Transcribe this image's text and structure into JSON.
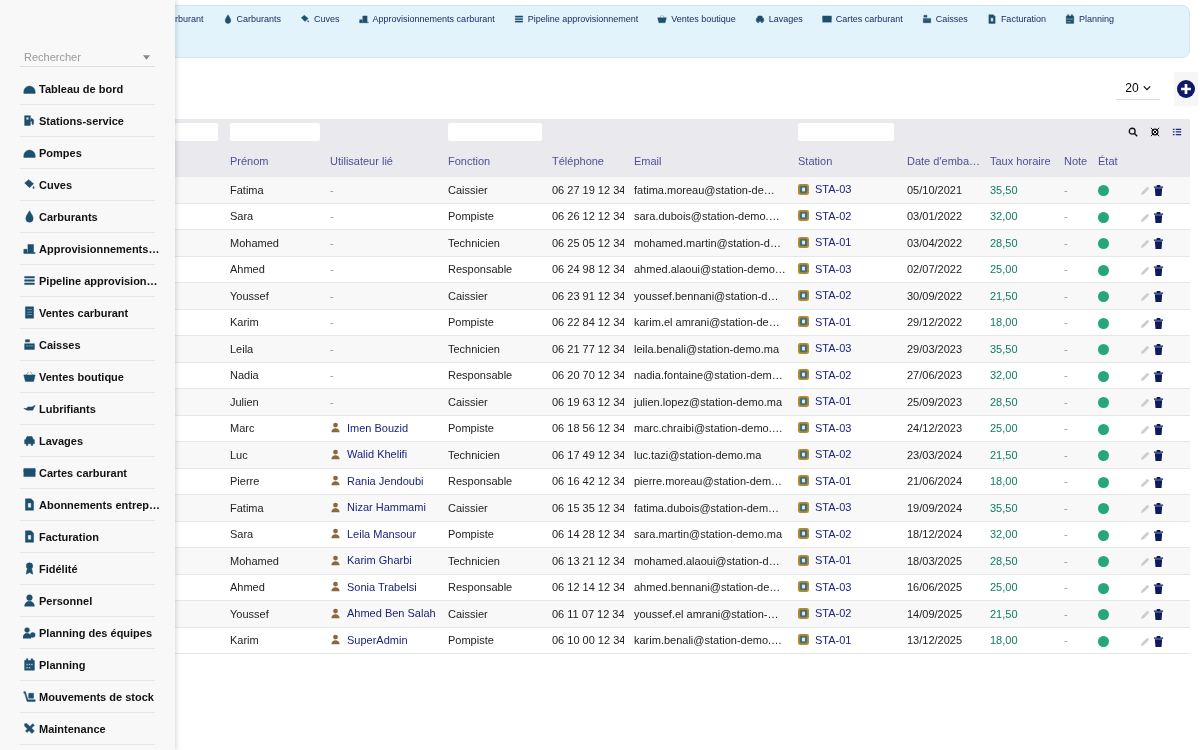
{
  "sidebar": {
    "search": {
      "placeholder": "Rechercher"
    },
    "items": [
      {
        "label": "Tableau de bord"
      },
      {
        "label": "Stations-service"
      },
      {
        "label": "Pompes"
      },
      {
        "label": "Cuves"
      },
      {
        "label": "Carburants"
      },
      {
        "label": "Approvisionnements…"
      },
      {
        "label": "Pipeline approvision…"
      },
      {
        "label": "Ventes carburant"
      },
      {
        "label": "Caisses"
      },
      {
        "label": "Ventes boutique"
      },
      {
        "label": "Lubrifiants"
      },
      {
        "label": "Lavages"
      },
      {
        "label": "Cartes carburant"
      },
      {
        "label": "Abonnements entrep…"
      },
      {
        "label": "Facturation"
      },
      {
        "label": "Fidélité"
      },
      {
        "label": "Personnel"
      },
      {
        "label": "Planning des équipes"
      },
      {
        "label": "Planning"
      },
      {
        "label": "Mouvements de stock"
      },
      {
        "label": "Maintenance"
      }
    ]
  },
  "top_nav": [
    {
      "label": "rburant"
    },
    {
      "label": "Carburants"
    },
    {
      "label": "Cuves"
    },
    {
      "label": "Approvisionnements carburant"
    },
    {
      "label": "Pipeline approvisionnement"
    },
    {
      "label": "Ventes boutique"
    },
    {
      "label": "Lavages"
    },
    {
      "label": "Cartes carburant"
    },
    {
      "label": "Caisses"
    },
    {
      "label": "Facturation"
    },
    {
      "label": "Planning"
    }
  ],
  "page_size": "20",
  "table": {
    "columns": [
      "Prénom",
      "Utilisateur lié",
      "Fonction",
      "Téléphone",
      "Email",
      "Station",
      "Date d'emba…",
      "Taux horaire",
      "Note",
      "État"
    ],
    "rows": [
      {
        "prenom": "Fatima",
        "user": "-",
        "linked": false,
        "fonction": "Caissier",
        "phone": "06 27 19 12 34",
        "email": "fatima.moreau@station-de…",
        "station": "STA-03",
        "date": "05/10/2021",
        "taux": "35,50",
        "note": "-",
        "active": true
      },
      {
        "prenom": "Sara",
        "user": "-",
        "linked": false,
        "fonction": "Pompiste",
        "phone": "06 26 12 12 34",
        "email": "sara.dubois@station-demo.…",
        "station": "STA-02",
        "date": "03/01/2022",
        "taux": "32,00",
        "note": "-",
        "active": true
      },
      {
        "prenom": "Mohamed",
        "user": "-",
        "linked": false,
        "fonction": "Technicien",
        "phone": "06 25 05 12 34",
        "email": "mohamed.martin@station-d…",
        "station": "STA-01",
        "date": "03/04/2022",
        "taux": "28,50",
        "note": "-",
        "active": true
      },
      {
        "prenom": "Ahmed",
        "user": "-",
        "linked": false,
        "fonction": "Responsable",
        "phone": "06 24 98 12 34",
        "email": "ahmed.alaoui@station-demo…",
        "station": "STA-03",
        "date": "02/07/2022",
        "taux": "25,00",
        "note": "-",
        "active": true
      },
      {
        "prenom": "Youssef",
        "user": "-",
        "linked": false,
        "fonction": "Caissier",
        "phone": "06 23 91 12 34",
        "email": "youssef.bennani@station-d…",
        "station": "STA-02",
        "date": "30/09/2022",
        "taux": "21,50",
        "note": "-",
        "active": true
      },
      {
        "prenom": "Karim",
        "user": "-",
        "linked": false,
        "fonction": "Pompiste",
        "phone": "06 22 84 12 34",
        "email": "karim.el amrani@station-de…",
        "station": "STA-01",
        "date": "29/12/2022",
        "taux": "18,00",
        "note": "-",
        "active": true
      },
      {
        "prenom": "Leila",
        "user": "-",
        "linked": false,
        "fonction": "Technicien",
        "phone": "06 21 77 12 34",
        "email": "leila.benali@station-demo.ma",
        "station": "STA-03",
        "date": "29/03/2023",
        "taux": "35,50",
        "note": "-",
        "active": true
      },
      {
        "prenom": "Nadia",
        "user": "-",
        "linked": false,
        "fonction": "Responsable",
        "phone": "06 20 70 12 34",
        "email": "nadia.fontaine@station-dem…",
        "station": "STA-02",
        "date": "27/06/2023",
        "taux": "32,00",
        "note": "-",
        "active": true
      },
      {
        "prenom": "Julien",
        "user": "-",
        "linked": false,
        "fonction": "Caissier",
        "phone": "06 19 63 12 34",
        "email": "julien.lopez@station-demo.ma",
        "station": "STA-01",
        "date": "25/09/2023",
        "taux": "28,50",
        "note": "-",
        "active": true
      },
      {
        "prenom": "Marc",
        "user": "Imen Bouzid",
        "linked": true,
        "fonction": "Pompiste",
        "phone": "06 18 56 12 34",
        "email": "marc.chraibi@station-demo.…",
        "station": "STA-03",
        "date": "24/12/2023",
        "taux": "25,00",
        "note": "-",
        "active": true
      },
      {
        "prenom": "Luc",
        "user": "Walid Khelifi",
        "linked": true,
        "fonction": "Technicien",
        "phone": "06 17 49 12 34",
        "email": "luc.tazi@station-demo.ma",
        "station": "STA-02",
        "date": "23/03/2024",
        "taux": "21,50",
        "note": "-",
        "active": true
      },
      {
        "prenom": "Pierre",
        "user": "Rania Jendoubi",
        "linked": true,
        "fonction": "Responsable",
        "phone": "06 16 42 12 34",
        "email": "pierre.moreau@station-dem…",
        "station": "STA-01",
        "date": "21/06/2024",
        "taux": "18,00",
        "note": "-",
        "active": true
      },
      {
        "prenom": "Fatima",
        "user": "Nizar Hammami",
        "linked": true,
        "fonction": "Caissier",
        "phone": "06 15 35 12 34",
        "email": "fatima.dubois@station-dem…",
        "station": "STA-03",
        "date": "19/09/2024",
        "taux": "35,50",
        "note": "-",
        "active": true
      },
      {
        "prenom": "Sara",
        "user": "Leila Mansour",
        "linked": true,
        "fonction": "Pompiste",
        "phone": "06 14 28 12 34",
        "email": "sara.martin@station-demo.ma",
        "station": "STA-02",
        "date": "18/12/2024",
        "taux": "32,00",
        "note": "-",
        "active": true
      },
      {
        "prenom": "Mohamed",
        "user": "Karim Gharbi",
        "linked": true,
        "fonction": "Technicien",
        "phone": "06 13 21 12 34",
        "email": "mohamed.alaoui@station-d…",
        "station": "STA-01",
        "date": "18/03/2025",
        "taux": "28,50",
        "note": "-",
        "active": true
      },
      {
        "prenom": "Ahmed",
        "user": "Sonia Trabelsi",
        "linked": true,
        "fonction": "Responsable",
        "phone": "06 12 14 12 34",
        "email": "ahmed.bennani@station-de…",
        "station": "STA-03",
        "date": "16/06/2025",
        "taux": "25,00",
        "note": "-",
        "active": true
      },
      {
        "prenom": "Youssef",
        "user": "Ahmed Ben Salah",
        "linked": true,
        "fonction": "Caissier",
        "phone": "06 11 07 12 34",
        "email": "youssef.el amrani@station-…",
        "station": "STA-02",
        "date": "14/09/2025",
        "taux": "21,50",
        "note": "-",
        "active": true
      },
      {
        "prenom": "Karim",
        "user": "SuperAdmin",
        "linked": true,
        "fonction": "Pompiste",
        "phone": "06 10 00 12 34",
        "email": "karim.benali@station-demo.…",
        "station": "STA-01",
        "date": "13/12/2025",
        "taux": "18,00",
        "note": "-",
        "active": true
      }
    ]
  }
}
